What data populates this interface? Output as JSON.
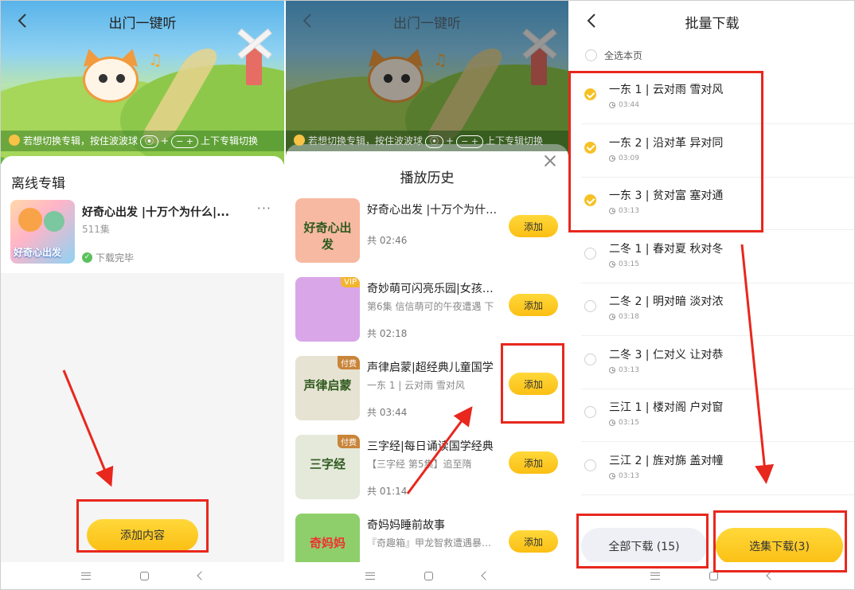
{
  "screen1": {
    "title": "出门一键听",
    "tip": {
      "text_a": "若想切换专辑，按住波波球",
      "key_a": "⦿",
      "key_b": "− +",
      "text_b": "上下专辑切换"
    },
    "section_title": "离线专辑",
    "album": {
      "title": "好奇心出发 |十万个为什么|...",
      "count": "511集",
      "status": "下载完毕",
      "cover_text": "好奇心出发"
    },
    "add_content_label": "添加内容"
  },
  "screen2": {
    "title": "出门一键听",
    "tip": {
      "text_a": "若想切换专辑，按住波波球",
      "key_a": "⦿",
      "key_b": "− +",
      "text_b": "上下专辑切换"
    },
    "sheet_title": "播放历史",
    "add_label": "添加",
    "items": [
      {
        "title": "好奇心出发 |十万个为什…",
        "sub": "",
        "time": "共 02:46",
        "tag": "",
        "cover_text": "好奇心出发",
        "color": "#f7b9a2"
      },
      {
        "title": "奇妙萌可闪亮乐园|女孩…",
        "sub": "第6集 信信萌可的午夜遭遇 下",
        "time": "共 02:18",
        "tag": "VIP",
        "cover_text": "",
        "color": "#d9a6e8"
      },
      {
        "title": "声律启蒙|超经典儿童国学",
        "sub": "一东 1 | 云对雨 雪对风",
        "time": "共 03:44",
        "tag": "付费",
        "cover_text": "声律启蒙",
        "color": "#e6e3d3"
      },
      {
        "title": "三字经|每日诵读国学经典",
        "sub": "【三字经 第5集】追至隋",
        "time": "共 01:14",
        "tag": "付费",
        "cover_text": "三字经",
        "color": "#e4e9da"
      },
      {
        "title": "奇妈妈睡前故事",
        "sub": "『奇趣箱』甲龙智救遭遇暴…",
        "time": "",
        "tag": "",
        "cover_text": "奇妈妈",
        "color": "#8fcf6b"
      }
    ]
  },
  "screen3": {
    "title": "批量下载",
    "select_all": "全选本页",
    "episodes": [
      {
        "title": "一东 1 | 云对雨 雪对风",
        "dur": "03:44",
        "checked": true
      },
      {
        "title": "一东 2 | 沿对革 异对同",
        "dur": "03:09",
        "checked": true
      },
      {
        "title": "一东 3 | 贫对富 塞对通",
        "dur": "03:13",
        "checked": true
      },
      {
        "title": "二冬 1 | 春对夏 秋对冬",
        "dur": "03:15",
        "checked": false
      },
      {
        "title": "二冬 2 | 明对暗 淡对浓",
        "dur": "03:18",
        "checked": false
      },
      {
        "title": "二冬 3 | 仁对义 让对恭",
        "dur": "03:13",
        "checked": false
      },
      {
        "title": "三江 1 | 楼对阁 户对窗",
        "dur": "03:15",
        "checked": false
      },
      {
        "title": "三江 2 | 旌对旆 盖对幢",
        "dur": "03:13",
        "checked": false
      }
    ],
    "download_all": "全部下载 (15)",
    "download_selected": "选集下载(3)"
  },
  "colors": {
    "accent": "#fbbf14",
    "annotation": "#e8271d",
    "check": "#f6c126"
  }
}
